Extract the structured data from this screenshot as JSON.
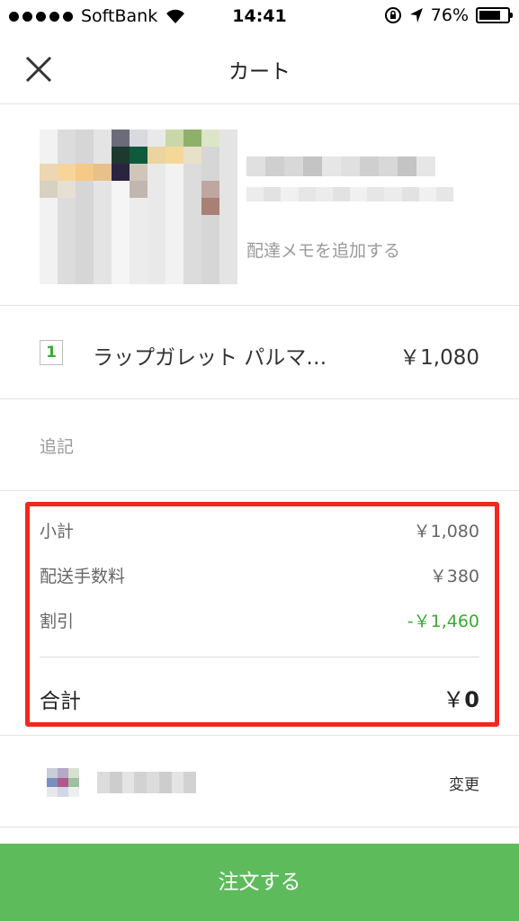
{
  "status_bar": {
    "carrier": "SoftBank",
    "time": "14:41",
    "battery": "76%",
    "battery_level": 0.76,
    "icons": [
      "signal-dots-icon",
      "wifi-icon",
      "orientation-lock-icon",
      "location-arrow-icon",
      "battery-icon"
    ]
  },
  "nav": {
    "title": "カート",
    "close_icon": "close-icon"
  },
  "store": {
    "add_memo": "配達メモを追加する"
  },
  "item": {
    "quantity": "1",
    "name": "ラップガレット パルマ…",
    "price": "￥1,080"
  },
  "note": {
    "placeholder": "追記"
  },
  "summary": {
    "subtotal_label": "小計",
    "subtotal_value": "￥1,080",
    "delivery_fee_label": "配送手数料",
    "delivery_fee_value": "￥380",
    "discount_label": "割引",
    "discount_value": "-￥1,460",
    "total_label": "合計",
    "total_currency": "￥",
    "total_value": "0",
    "highlight_color": "#f0281e",
    "discount_color": "#3aaa35"
  },
  "payment": {
    "change_label": "変更"
  },
  "order_button": {
    "label": "注文する",
    "color": "#5dbb5b"
  }
}
